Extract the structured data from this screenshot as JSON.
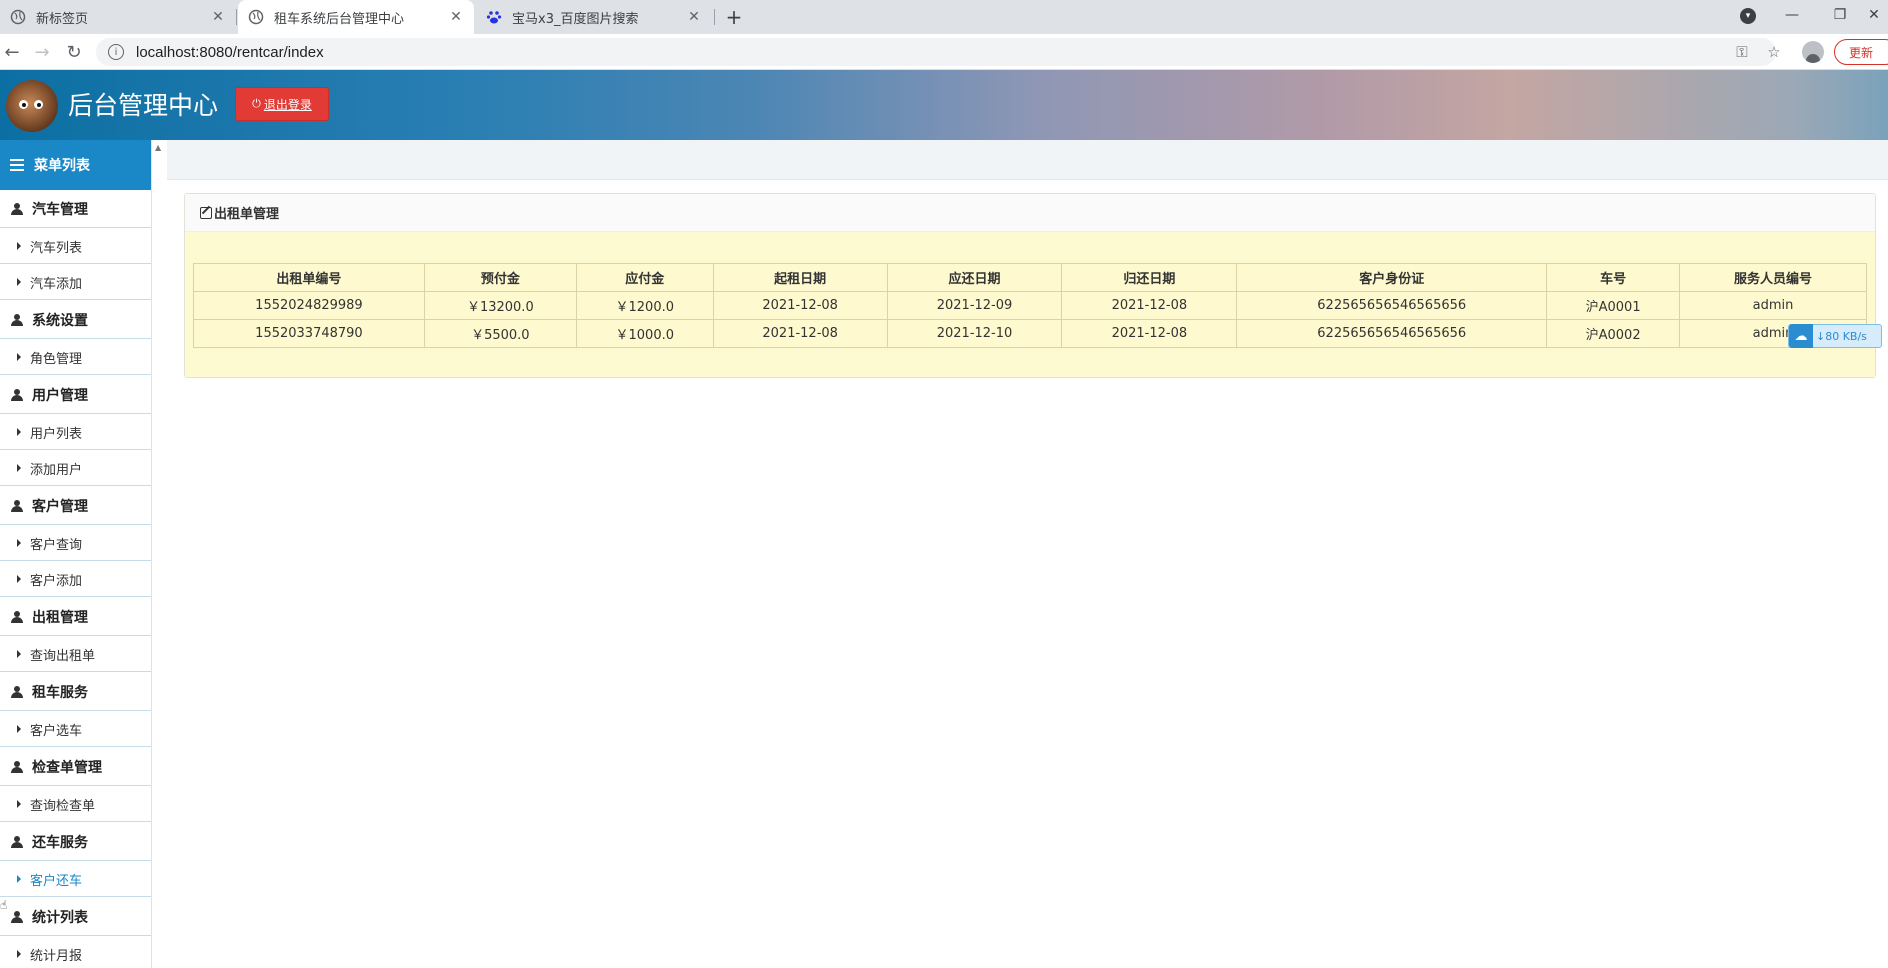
{
  "browser": {
    "tabs": [
      {
        "title": "新标签页",
        "icon": "globe-icon"
      },
      {
        "title": "租车系统后台管理中心",
        "icon": "globe-icon"
      },
      {
        "title": "宝马x3_百度图片搜索",
        "icon": "baidu-paw-icon"
      }
    ],
    "url": "localhost:8080/rentcar/index",
    "update_label": "更新"
  },
  "header": {
    "title": "后台管理中心",
    "logout_label": "退出登录"
  },
  "sidebar": {
    "title": "菜单列表",
    "items": [
      {
        "type": "group",
        "label": "汽车管理"
      },
      {
        "type": "sub",
        "label": "汽车列表"
      },
      {
        "type": "sub",
        "label": "汽车添加"
      },
      {
        "type": "group",
        "label": "系统设置"
      },
      {
        "type": "sub",
        "label": "角色管理"
      },
      {
        "type": "group",
        "label": "用户管理"
      },
      {
        "type": "sub",
        "label": "用户列表"
      },
      {
        "type": "sub",
        "label": "添加用户"
      },
      {
        "type": "group",
        "label": "客户管理"
      },
      {
        "type": "sub",
        "label": "客户查询"
      },
      {
        "type": "sub",
        "label": "客户添加"
      },
      {
        "type": "group",
        "label": "出租管理"
      },
      {
        "type": "sub",
        "label": "查询出租单"
      },
      {
        "type": "group",
        "label": "租车服务"
      },
      {
        "type": "sub",
        "label": "客户选车"
      },
      {
        "type": "group",
        "label": "检查单管理"
      },
      {
        "type": "sub",
        "label": "查询检查单"
      },
      {
        "type": "group",
        "label": "还车服务"
      },
      {
        "type": "sub",
        "label": "客户还车",
        "active": true
      },
      {
        "type": "group",
        "label": "统计列表"
      },
      {
        "type": "sub",
        "label": "统计月报"
      }
    ]
  },
  "panel": {
    "title": "出租单管理",
    "table": {
      "headers": [
        "出租单编号",
        "预付金",
        "应付金",
        "起租日期",
        "应还日期",
        "归还日期",
        "客户身份证",
        "车号",
        "服务人员编号"
      ],
      "rows": [
        [
          "1552024829989",
          "￥13200.0",
          "￥1200.0",
          "2021-12-08",
          "2021-12-09",
          "2021-12-08",
          "622565656546565656",
          "沪A0001",
          "admin"
        ],
        [
          "1552033748790",
          "￥5500.0",
          "￥1000.0",
          "2021-12-08",
          "2021-12-10",
          "2021-12-08",
          "622565656546565656",
          "沪A0002",
          "admin"
        ]
      ]
    }
  },
  "download_speed": "80 KB/s",
  "colors": {
    "sidebar_head": "#1a87c7",
    "logout_button": "#e23a34",
    "table_bg": "#fef9cf",
    "active_menu": "#1a87c7"
  }
}
